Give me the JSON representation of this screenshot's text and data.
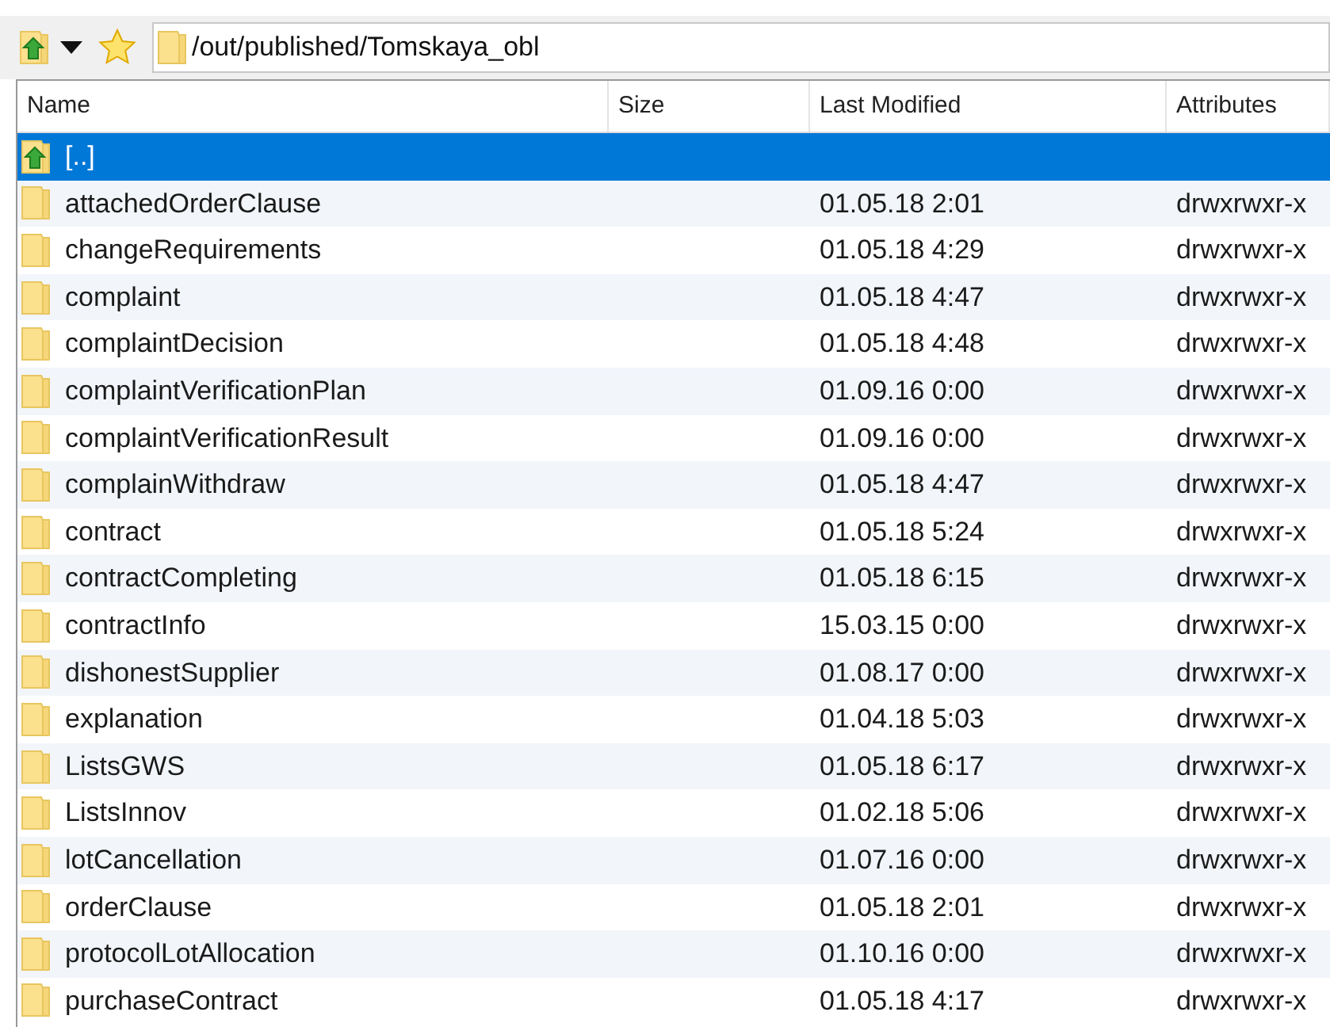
{
  "path": "/out/published/Tomskaya_obl",
  "columns": [
    "Name",
    "Size",
    "Last Modified",
    "Attributes"
  ],
  "rows": [
    {
      "kind": "parent",
      "name": "[..]",
      "modified": "",
      "attributes": "",
      "selected": true
    },
    {
      "kind": "folder",
      "name": "attachedOrderClause",
      "modified": "01.05.18 2:01",
      "attributes": "drwxrwxr-x",
      "selected": false
    },
    {
      "kind": "folder",
      "name": "changeRequirements",
      "modified": "01.05.18 4:29",
      "attributes": "drwxrwxr-x",
      "selected": false
    },
    {
      "kind": "folder",
      "name": "complaint",
      "modified": "01.05.18 4:47",
      "attributes": "drwxrwxr-x",
      "selected": false
    },
    {
      "kind": "folder",
      "name": "complaintDecision",
      "modified": "01.05.18 4:48",
      "attributes": "drwxrwxr-x",
      "selected": false
    },
    {
      "kind": "folder",
      "name": "complaintVerificationPlan",
      "modified": "01.09.16 0:00",
      "attributes": "drwxrwxr-x",
      "selected": false
    },
    {
      "kind": "folder",
      "name": "complaintVerificationResult",
      "modified": "01.09.16 0:00",
      "attributes": "drwxrwxr-x",
      "selected": false
    },
    {
      "kind": "folder",
      "name": "complainWithdraw",
      "modified": "01.05.18 4:47",
      "attributes": "drwxrwxr-x",
      "selected": false
    },
    {
      "kind": "folder",
      "name": "contract",
      "modified": "01.05.18 5:24",
      "attributes": "drwxrwxr-x",
      "selected": false
    },
    {
      "kind": "folder",
      "name": "contractCompleting",
      "modified": "01.05.18 6:15",
      "attributes": "drwxrwxr-x",
      "selected": false
    },
    {
      "kind": "folder",
      "name": "contractInfo",
      "modified": "15.03.15 0:00",
      "attributes": "drwxrwxr-x",
      "selected": false
    },
    {
      "kind": "folder",
      "name": "dishonestSupplier",
      "modified": "01.08.17 0:00",
      "attributes": "drwxrwxr-x",
      "selected": false
    },
    {
      "kind": "folder",
      "name": "explanation",
      "modified": "01.04.18 5:03",
      "attributes": "drwxrwxr-x",
      "selected": false
    },
    {
      "kind": "folder",
      "name": "ListsGWS",
      "modified": "01.05.18 6:17",
      "attributes": "drwxrwxr-x",
      "selected": false
    },
    {
      "kind": "folder",
      "name": "ListsInnov",
      "modified": "01.02.18 5:06",
      "attributes": "drwxrwxr-x",
      "selected": false
    },
    {
      "kind": "folder",
      "name": "lotCancellation",
      "modified": "01.07.16 0:00",
      "attributes": "drwxrwxr-x",
      "selected": false
    },
    {
      "kind": "folder",
      "name": "orderClause",
      "modified": "01.05.18 2:01",
      "attributes": "drwxrwxr-x",
      "selected": false
    },
    {
      "kind": "folder",
      "name": "protocolLotAllocation",
      "modified": "01.10.16 0:00",
      "attributes": "drwxrwxr-x",
      "selected": false
    },
    {
      "kind": "folder",
      "name": "purchaseContract",
      "modified": "01.05.18 4:17",
      "attributes": "drwxrwxr-x",
      "selected": false
    }
  ]
}
